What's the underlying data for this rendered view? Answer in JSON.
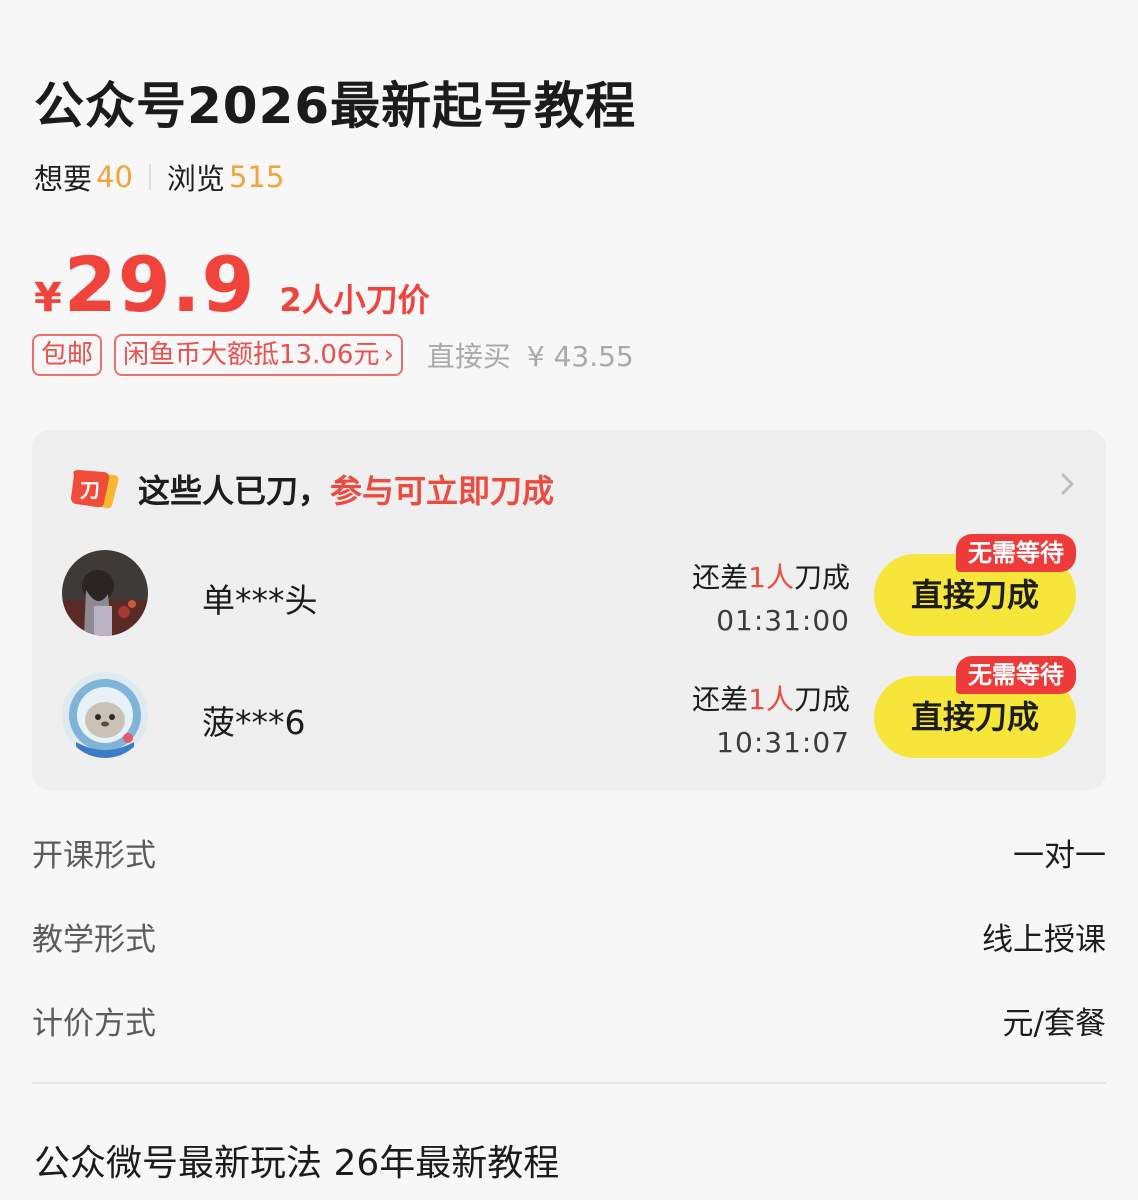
{
  "product": {
    "title": "公众号2026最新起号教程",
    "want_label": "想要",
    "want_count": "40",
    "view_label": "浏览",
    "view_count": "515"
  },
  "price": {
    "currency": "¥",
    "value": "29.9",
    "group_label": "2人小刀价",
    "tags": [
      "包邮",
      "闲鱼币大额抵13.06元"
    ],
    "tag_chevron": "›",
    "direct_label": "直接买",
    "direct_price": "¥ 43.55"
  },
  "bargain": {
    "heading": "这些人已刀，",
    "heading_highlight": "参与可立即刀成",
    "rows": [
      {
        "name": "单***头",
        "remain_prefix": "还差",
        "remain_count": "1人",
        "remain_suffix": "刀成",
        "timer": "01:31:00",
        "badge": "无需等待",
        "button": "直接刀成"
      },
      {
        "name": "菠***6",
        "remain_prefix": "还差",
        "remain_count": "1人",
        "remain_suffix": "刀成",
        "timer": "10:31:07",
        "badge": "无需等待",
        "button": "直接刀成"
      }
    ]
  },
  "properties": [
    {
      "key": "开课形式",
      "value": "一对一"
    },
    {
      "key": "教学形式",
      "value": "线上授课"
    },
    {
      "key": "计价方式",
      "value": "元/套餐"
    }
  ],
  "description": "公众微号最新玩法 26年最新教程",
  "colors": {
    "accent_red": "#f0433c",
    "highlight_orange": "#f2a33a",
    "button_yellow": "#f6e63a",
    "badge_red": "#ee3a3a"
  },
  "icons": [
    "knife-badge-icon",
    "chevron-right-icon",
    "user-avatar"
  ]
}
